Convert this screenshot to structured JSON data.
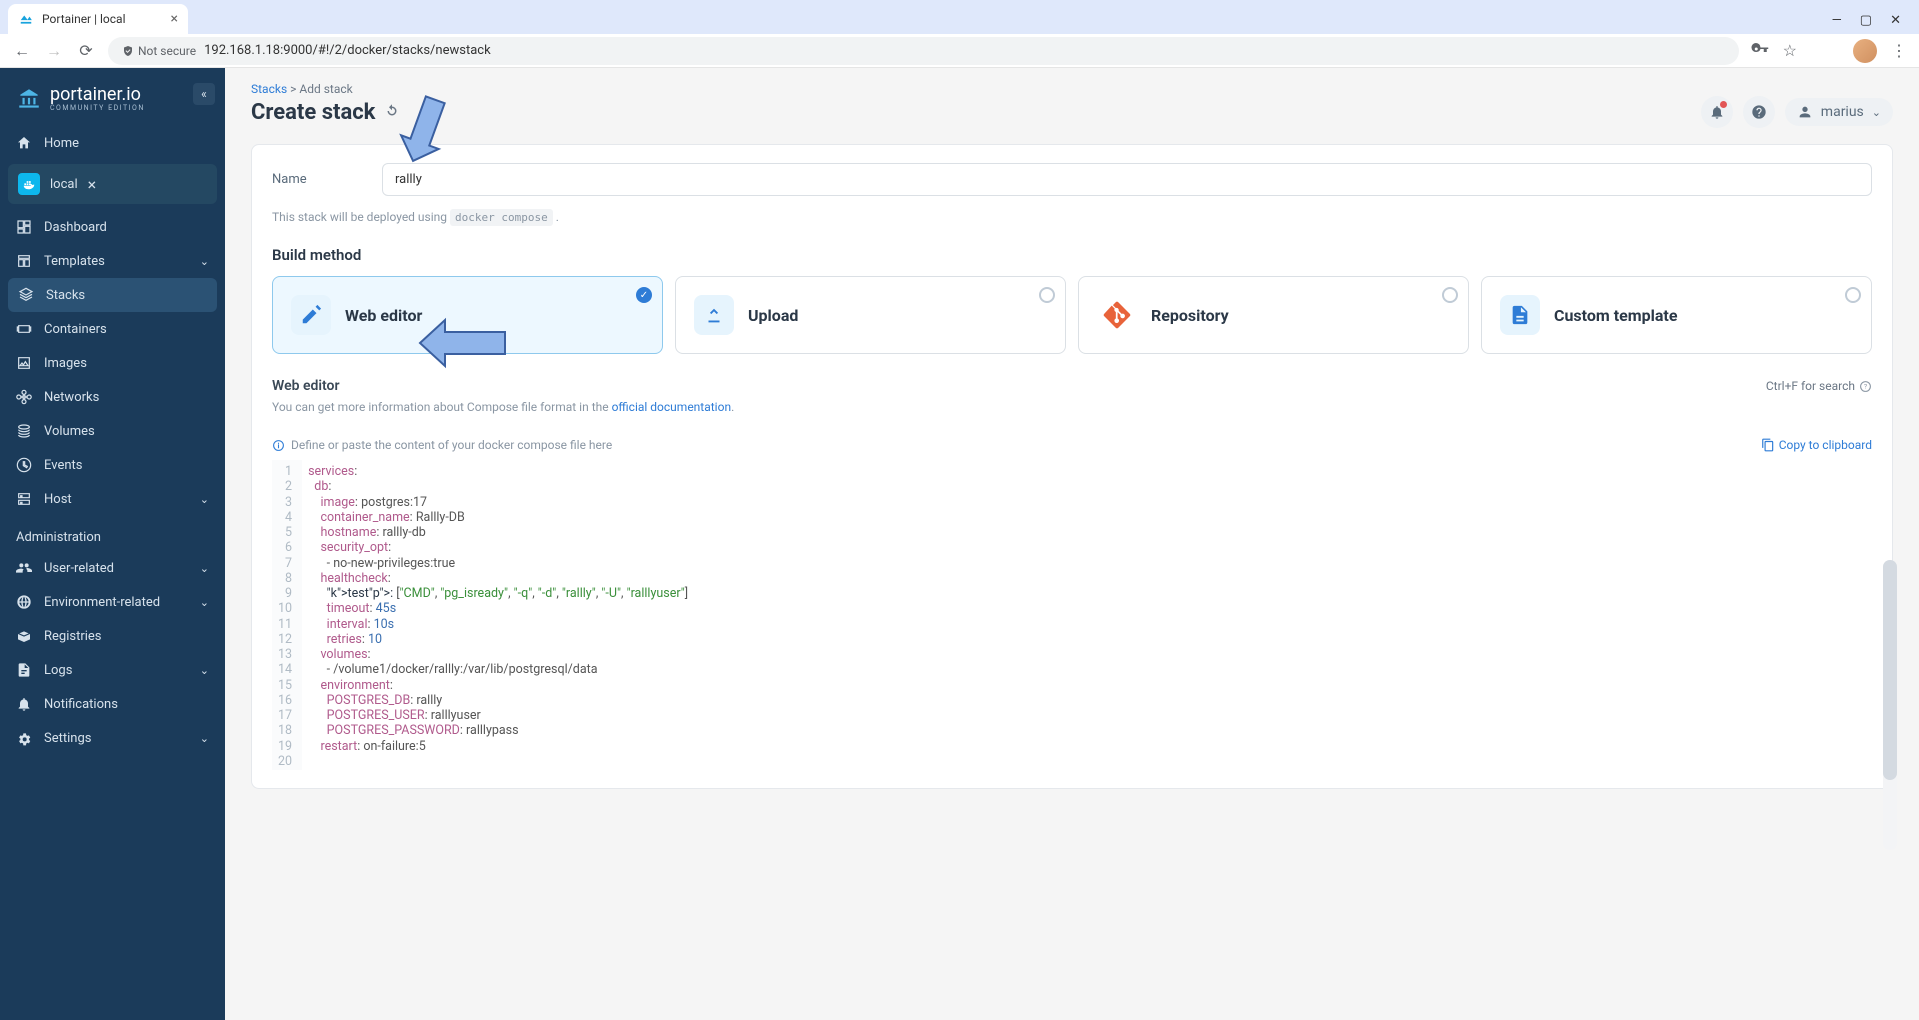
{
  "browser": {
    "tab_title": "Portainer | local",
    "url": "192.168.1.18:9000/#!/2/docker/stacks/newstack",
    "security_label": "Not secure"
  },
  "app": {
    "brand": "portainer.io",
    "brand_sub": "COMMUNITY EDITION",
    "breadcrumb_root": "Stacks",
    "breadcrumb_leaf": "Add stack",
    "page_title": "Create stack",
    "user": "marius"
  },
  "sidebar": {
    "home": "Home",
    "env": "local",
    "items": [
      "Dashboard",
      "Templates",
      "Stacks",
      "Containers",
      "Images",
      "Networks",
      "Volumes",
      "Events",
      "Host"
    ],
    "admin_heading": "Administration",
    "admin_items": [
      "User-related",
      "Environment-related",
      "Registries",
      "Logs",
      "Notifications",
      "Settings"
    ]
  },
  "form": {
    "name_label": "Name",
    "name_value": "rallly",
    "deploy_hint_pre": "This stack will be deployed using ",
    "deploy_hint_code": "docker compose",
    "build_heading": "Build method",
    "methods": {
      "web": "Web editor",
      "upload": "Upload",
      "repo": "Repository",
      "custom": "Custom template"
    },
    "editor_heading": "Web editor",
    "search_hint": "Ctrl+F for search",
    "editor_sub_pre": "You can get more information about Compose file format in the ",
    "editor_sub_link": "official documentation",
    "define_hint": "Define or paste the content of your docker compose file here",
    "copy_btn": "Copy to clipboard"
  },
  "code_lines": [
    "services:",
    "  db:",
    "    image: postgres:17",
    "    container_name: Rallly-DB",
    "    hostname: rallly-db",
    "    security_opt:",
    "      - no-new-privileges:true",
    "    healthcheck:",
    "      test: [\"CMD\", \"pg_isready\", \"-q\", \"-d\", \"rallly\", \"-U\", \"ralllyuser\"]",
    "      timeout: 45s",
    "      interval: 10s",
    "      retries: 10",
    "    volumes:",
    "      - /volume1/docker/rallly:/var/lib/postgresql/data",
    "    environment:",
    "      POSTGRES_DB: rallly",
    "      POSTGRES_USER: ralllyuser",
    "      POSTGRES_PASSWORD: ralllypass",
    "    restart: on-failure:5",
    "    "
  ]
}
